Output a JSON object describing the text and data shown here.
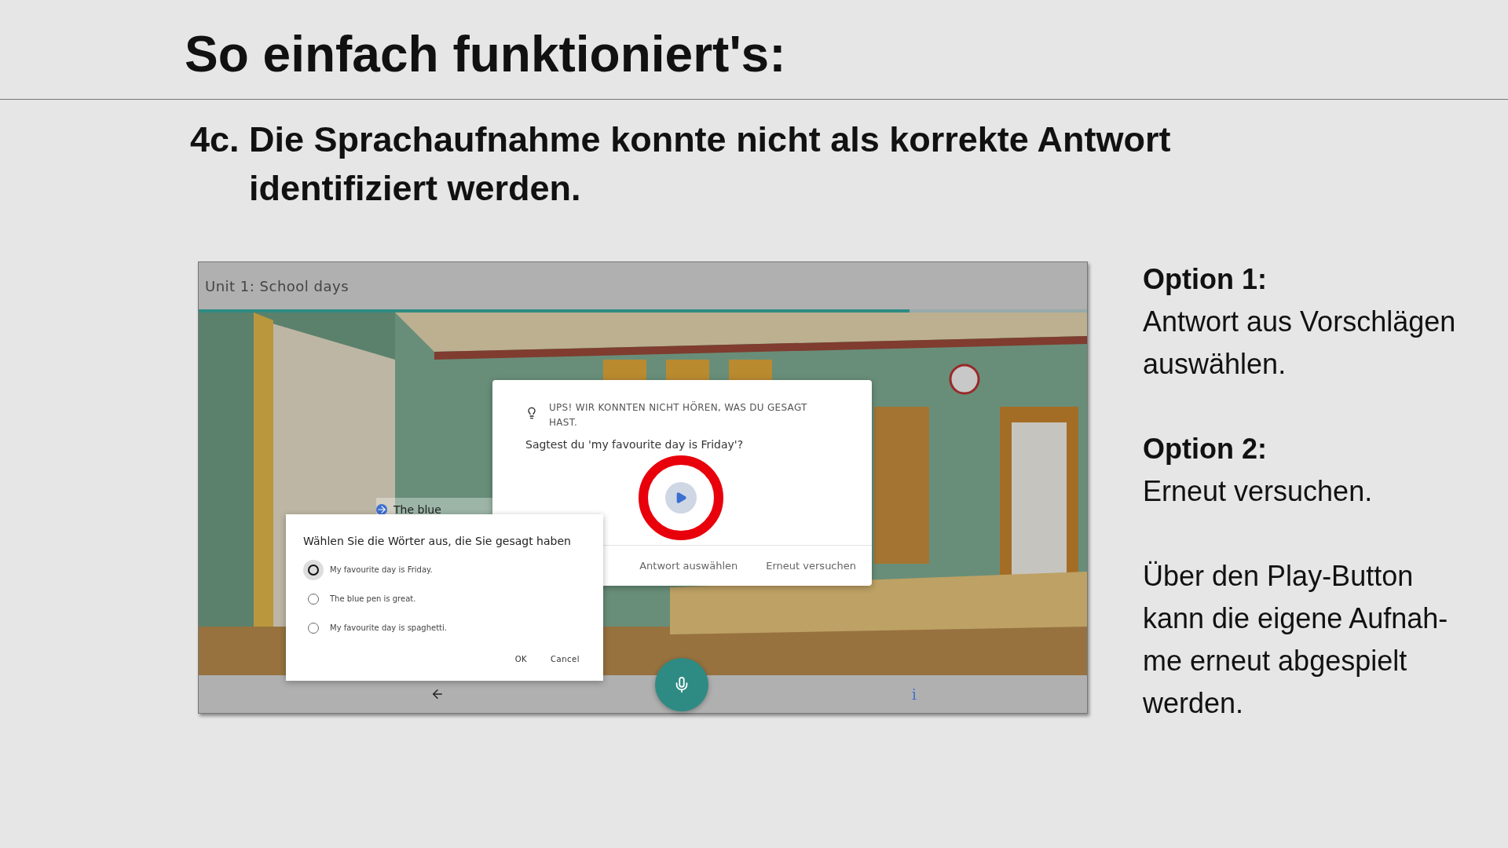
{
  "slide": {
    "title": "So einfach funktioniert's:",
    "step": {
      "number": "4c.",
      "text": "Die Sprachaufnahme konnte nicht als korrekte Antwort identifiziert werden."
    }
  },
  "app": {
    "header": "Unit 1: School days",
    "progress": {
      "level": 0.8
    },
    "hint": "The blue",
    "error_dialog": {
      "message": "UPS! WIR KONNTEN NICHT HÖREN, WAS DU GESAGT HAST.",
      "question": "Sagtest du 'my favourite day is Friday'?",
      "actions": [
        "Antwort auswählen",
        "Erneut versuchen"
      ]
    },
    "choice_dialog": {
      "title": "Wählen Sie die Wörter aus, die Sie gesagt haben",
      "options": [
        {
          "label": "My favourite day is Friday.",
          "selected": true
        },
        {
          "label": "The blue pen is great.",
          "selected": false
        },
        {
          "label": "My favourite day is spaghetti.",
          "selected": false
        }
      ],
      "buttons": [
        "OK",
        "Cancel"
      ]
    },
    "bottom_bar": {
      "info": "i"
    }
  },
  "notes": [
    {
      "heading": "Option 1:",
      "text": "Antwort aus Vorschlägen auswählen."
    },
    {
      "heading": "Option 2:",
      "text": "Erneut versuchen."
    },
    {
      "text": "Über den Play-Button kann die eigene Aufnah-me erneut abgespielt werden."
    }
  ]
}
